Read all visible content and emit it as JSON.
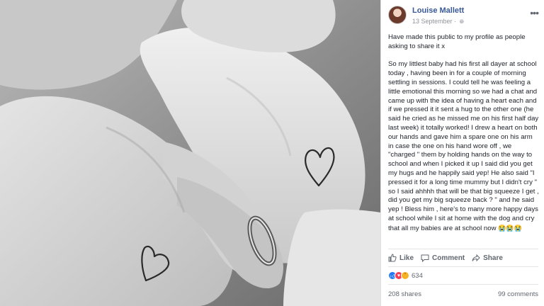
{
  "post": {
    "author": "Louise Mallett",
    "date": "13 September ·",
    "paragraphs": [
      "Have made this public to my profile as people asking to share it x",
      "So my littlest baby had his first all dayer at school today , having been in for a couple of morning settling in sessions. I could tell he was feeling a little emotional this morning so we had a chat and came up with the idea of having a heart each and if we pressed it it sent a hug to the other one (he said he cried as he missed me on his first half day last week) it totally worked! I drew a heart on both our hands and gave him a spare one on his arm in case the one on his hand wore off , we \"charged \" them by holding hands on the way to school and when I picked it up I said did you get my hugs and he happily said yep! He also said \"I pressed it for a long time mummy but I didn't cry \" so I said ahhhh that will be that big squeeze I get , did you get my big squeeze back ? \" and he said yep ! Bless him , here's to many more happy days at school while I sit at home with the dog and cry that all my babies are at school now"
    ],
    "emoji_tail": "😭😭😭"
  },
  "actions": {
    "like": "Like",
    "comment": "Comment",
    "share": "Share"
  },
  "stats": {
    "reaction_count": "634",
    "shares": "208 shares",
    "comments": "99 comments"
  },
  "icons": {
    "more": "more-options-icon",
    "privacy": "globe-icon",
    "like": "thumbs-up-icon",
    "comment": "speech-bubble-icon",
    "share": "share-arrow-icon"
  },
  "colors": {
    "author_link": "#385898",
    "like_blue": "#2078f4",
    "love_red": "#f33e58",
    "muted_text": "#606770"
  }
}
